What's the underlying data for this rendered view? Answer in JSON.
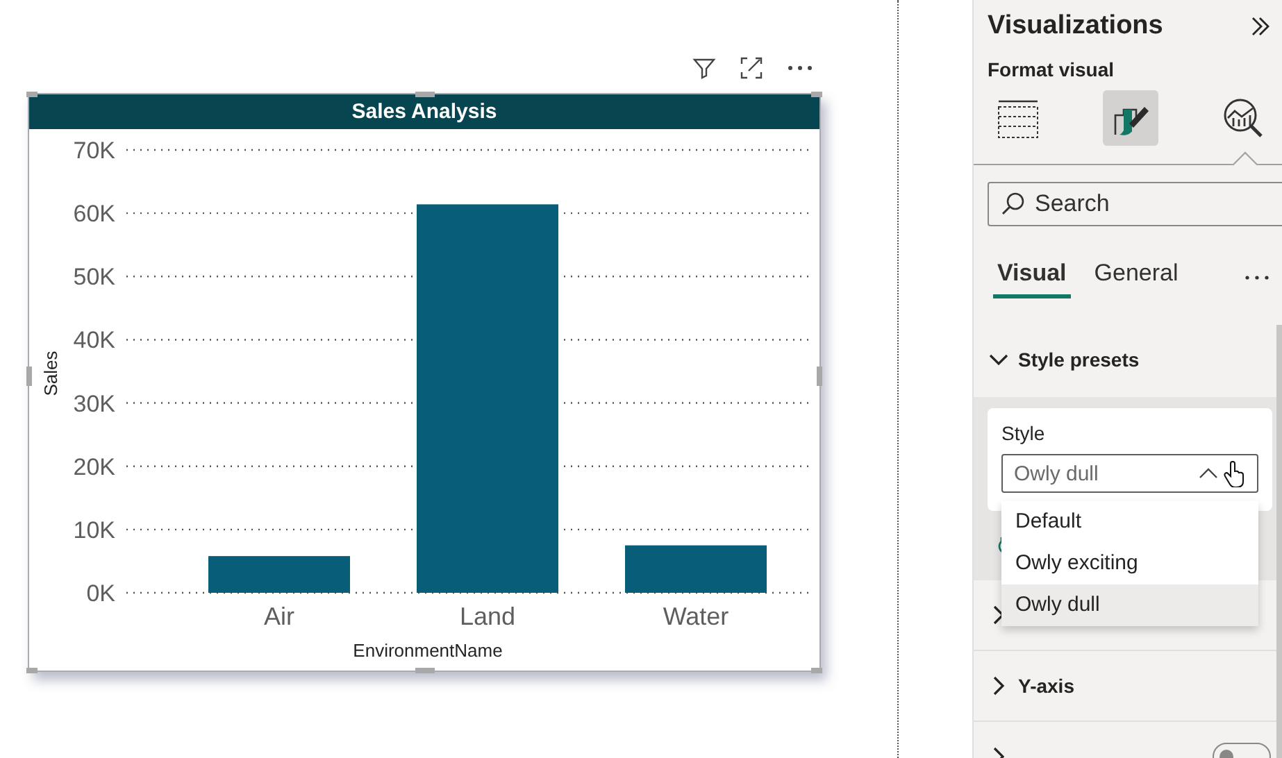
{
  "report": {
    "visual": {
      "chart_data": {
        "type": "bar",
        "title": "Sales Analysis",
        "xlabel": "EnvironmentName",
        "ylabel": "Sales",
        "categories": [
          "Air",
          "Land",
          "Water"
        ],
        "values": [
          5800,
          61400,
          7500
        ],
        "grid": true,
        "ylim": [
          0,
          70000
        ],
        "yticks": [
          {
            "value": 0,
            "label": "0K"
          },
          {
            "value": 10000,
            "label": "10K"
          },
          {
            "value": 20000,
            "label": "20K"
          },
          {
            "value": 30000,
            "label": "30K"
          },
          {
            "value": 40000,
            "label": "40K"
          },
          {
            "value": 50000,
            "label": "50K"
          },
          {
            "value": 60000,
            "label": "60K"
          },
          {
            "value": 70000,
            "label": "70K"
          }
        ]
      }
    }
  },
  "pane": {
    "title": "Visualizations",
    "subtitle": "Format visual",
    "view_icons": [
      {
        "kind": "build",
        "selected": false
      },
      {
        "kind": "format",
        "selected": true
      },
      {
        "kind": "analytics",
        "selected": false
      }
    ],
    "search": {
      "placeholder": "Search"
    },
    "tabs": [
      {
        "label": "Visual",
        "selected": true
      },
      {
        "label": "General",
        "selected": false
      }
    ],
    "presets": {
      "label": "Style presets",
      "expanded": true,
      "field_label": "Style",
      "value": "Owly dull",
      "open": true,
      "options": [
        {
          "label": "Default",
          "selected": false
        },
        {
          "label": "Owly exciting",
          "selected": false
        },
        {
          "label": "Owly dull",
          "selected": true
        }
      ]
    },
    "sections": [
      {
        "expanded": false
      },
      {
        "label": "Y-axis",
        "expanded": false
      },
      {
        "expanded": false,
        "toggle": {
          "on": false
        }
      }
    ]
  }
}
